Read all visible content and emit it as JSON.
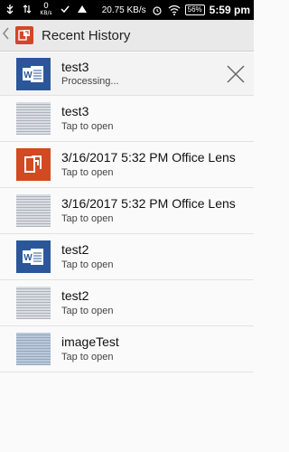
{
  "status_bar": {
    "kb_value": "0",
    "kb_unit": "KB/s",
    "speed": "20.75 KB/s",
    "battery": "56%",
    "time": "5:59 pm"
  },
  "app_bar": {
    "title": "Recent History"
  },
  "items": [
    {
      "title": "test3",
      "subtitle": "Processing...",
      "thumb": "word-doc-icon"
    },
    {
      "title": "test3",
      "subtitle": "Tap to open",
      "thumb": "scanned-page-thumbnail"
    },
    {
      "title": "3/16/2017 5:32 PM Office Lens",
      "subtitle": "Tap to open",
      "thumb": "office-lens-icon"
    },
    {
      "title": "3/16/2017 5:32 PM Office Lens",
      "subtitle": "Tap to open",
      "thumb": "scanned-page-thumbnail"
    },
    {
      "title": "test2",
      "subtitle": "Tap to open",
      "thumb": "word-doc-icon"
    },
    {
      "title": "test2",
      "subtitle": "Tap to open",
      "thumb": "scanned-page-thumbnail"
    },
    {
      "title": "imageTest",
      "subtitle": "Tap to open",
      "thumb": "scanned-page-thumbnail"
    }
  ]
}
